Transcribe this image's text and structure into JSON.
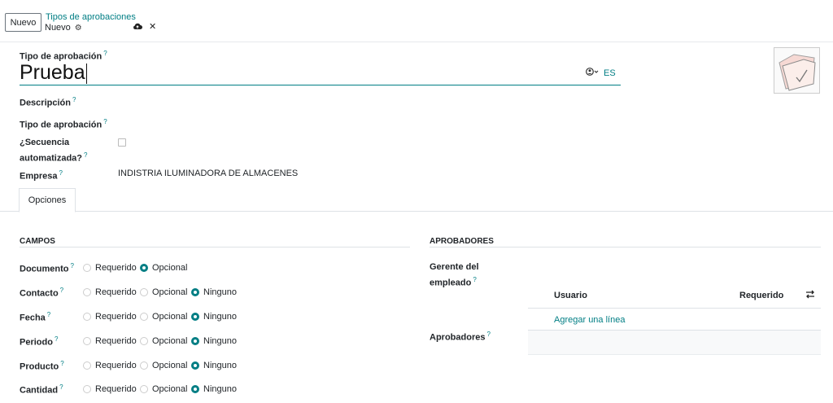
{
  "controlbar": {
    "new_button": "Nuevo",
    "breadcrumb_parent": "Tipos de aprobaciones",
    "breadcrumb_current": "Nuevo",
    "icons": [
      "gear-icon",
      "cloud-upload-icon",
      "close-icon"
    ]
  },
  "form": {
    "name_label": "Tipo de aprobación",
    "name_value": "Prueba",
    "lang": "ES",
    "description_label": "Descripción",
    "type_label": "Tipo de aprobación",
    "sequence_label_1": "¿Secuencia",
    "sequence_label_2": "automatizada?",
    "company_label": "Empresa",
    "company_value": "INDISTRIA ILUMINADORA DE ALMACENES",
    "help_mark": "?"
  },
  "tabs": [
    {
      "label": "Opciones"
    }
  ],
  "fields_section": {
    "title": "CAMPOS",
    "options": {
      "required": "Requerido",
      "optional": "Opcional",
      "none": "Ninguno"
    },
    "rows": [
      {
        "label": "Documento",
        "selected": "optional",
        "has_none": false
      },
      {
        "label": "Contacto",
        "selected": "none",
        "has_none": true
      },
      {
        "label": "Fecha",
        "selected": "none",
        "has_none": true
      },
      {
        "label": "Periodo",
        "selected": "none",
        "has_none": true
      },
      {
        "label": "Producto",
        "selected": "none",
        "has_none": true
      },
      {
        "label": "Cantidad",
        "selected": "none",
        "has_none": true
      }
    ]
  },
  "approvers_section": {
    "title": "APROBADORES",
    "manager_label_1": "Gerente del",
    "manager_label_2": "empleado",
    "approvers_label": "Aprobadores",
    "table": {
      "col_user": "Usuario",
      "col_required": "Requerido",
      "add_line": "Agregar una línea"
    }
  },
  "colors": {
    "accent": "#017e84",
    "text": "#212529",
    "border": "#dee2e6"
  }
}
